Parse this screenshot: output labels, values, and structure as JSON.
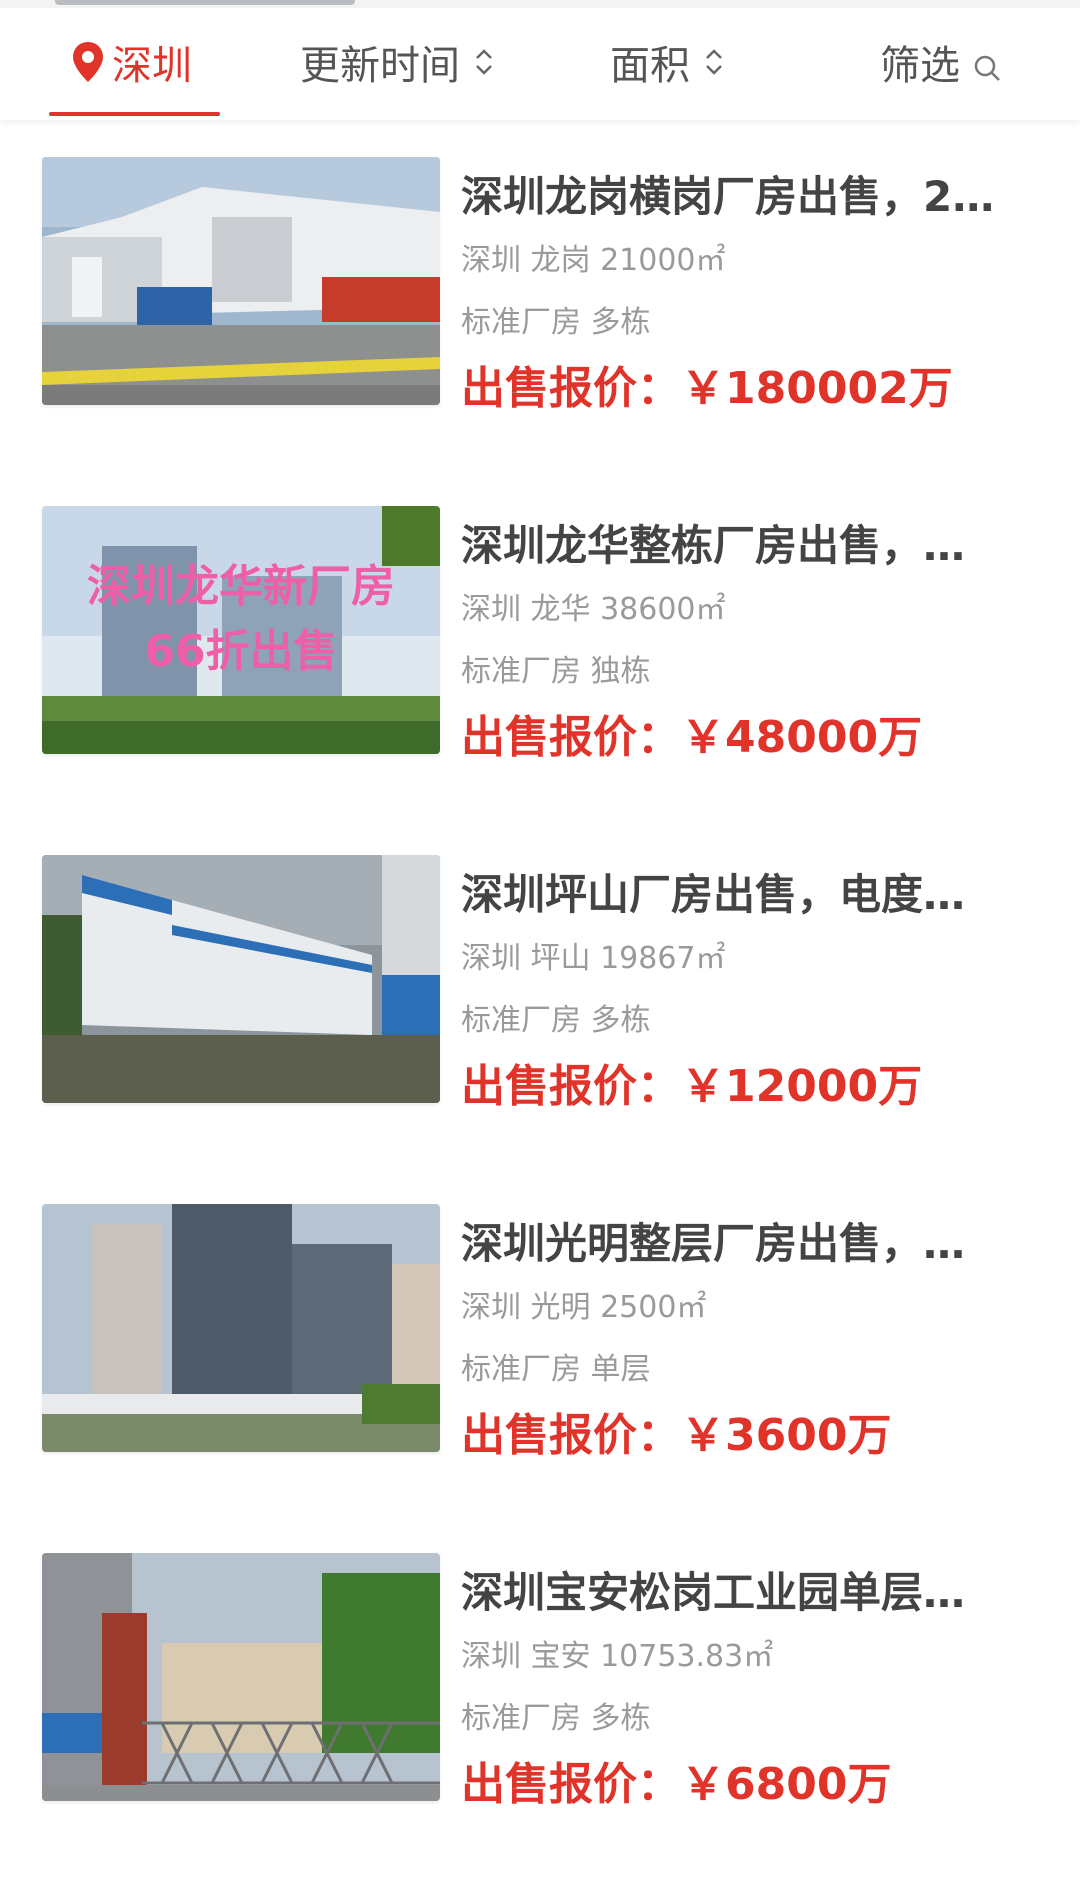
{
  "filter_bar": {
    "city_label": "深圳",
    "update_label": "更新时间",
    "area_label": "面积",
    "screen_label": "筛选",
    "icons": [
      "location-pin-icon",
      "sort-updown-icon",
      "search-icon"
    ],
    "accent_color": "#e0332a"
  },
  "listings": [
    {
      "title": "深圳龙岗横岗厂房出售，2…",
      "location": "深圳 龙岗 21000㎡",
      "type": "标准厂房 多栋",
      "price_label": "出售报价：",
      "price": "￥180002万"
    },
    {
      "title": "深圳龙华整栋厂房出售，…",
      "location": "深圳 龙华 38600㎡",
      "type": "标准厂房 独栋",
      "price_label": "出售报价：",
      "price": "￥48000万",
      "image_overlay_line1": "深圳龙华新厂房",
      "image_overlay_line2": "66折出售"
    },
    {
      "title": "深圳坪山厂房出售，电度…",
      "location": "深圳 坪山 19867㎡",
      "type": "标准厂房 多栋",
      "price_label": "出售报价：",
      "price": "￥12000万"
    },
    {
      "title": "深圳光明整层厂房出售，…",
      "location": "深圳 光明 2500㎡",
      "type": "标准厂房 单层",
      "price_label": "出售报价：",
      "price": "￥3600万"
    },
    {
      "title": "深圳宝安松岗工业园单层…",
      "location": "深圳 宝安 10753.83㎡",
      "type": "标准厂房 多栋",
      "price_label": "出售报价：",
      "price": "￥6800万"
    }
  ]
}
